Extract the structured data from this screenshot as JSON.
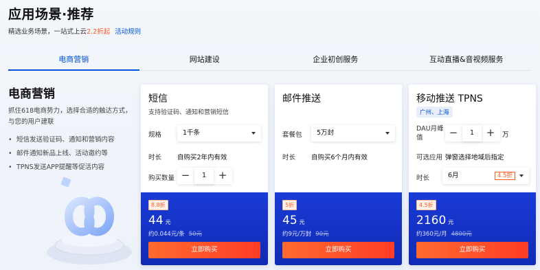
{
  "header": {
    "title": "应用场景·推荐",
    "subtitle_prefix": "精选业务场景，一站式上云",
    "subtitle_highlight": "2.2折起",
    "rule_link": "活动规则"
  },
  "tabs": [
    "电商营销",
    "网站建设",
    "企业初创服务",
    "互动直播&音视频服务"
  ],
  "intro": {
    "title": "电商营销",
    "desc": "抓住618电商势力，选择合适的触达方式，与您的用户建联",
    "bullets": [
      "短信发送验证码、通知和营销内容",
      "邮件通知新品上线、活动邀约等",
      "TPNS发送APP提醒等促活内容"
    ]
  },
  "cards": [
    {
      "title": "短信",
      "subtitle": "支持验证码、通知和营销短信",
      "spec_label": "规格",
      "spec_value": "1千条",
      "duration_label": "时长",
      "duration_value": "自购买2年内有效",
      "qty_label": "购买数量",
      "qty_value": "1",
      "discount": "8.8折",
      "price": "44",
      "price_unit": "元",
      "unit_price": "约0.044元/条",
      "orig_price": "50元",
      "buy_label": "立即购买"
    },
    {
      "title": "邮件推送",
      "package_label": "套餐包",
      "package_value": "5万封",
      "duration_label": "时长",
      "duration_value": "自购买6个月内有效",
      "discount": "5折",
      "price": "45",
      "price_unit": "元",
      "unit_price": "约9元/万封",
      "orig_price": "90元",
      "buy_label": "立即购买"
    },
    {
      "title": "移动推送 TPNS",
      "region_tag": "广州、上海",
      "dau_label": "DAU月峰值",
      "dau_value": "1",
      "dau_unit": "万",
      "app_label": "可选应用",
      "app_value": "弹窗选择地域后指定",
      "duration_label": "时长",
      "duration_value": "6月",
      "duration_discount": "4.5折",
      "discount": "4.5折",
      "price": "2160",
      "price_unit": "元",
      "unit_price": "约360元/月",
      "orig_price": "4800元",
      "buy_label": "立即购买"
    }
  ],
  "symbols": {
    "minus": "−",
    "plus": "+"
  },
  "colors": {
    "accent": "#0052d9",
    "price_bg": "#1a3bd6",
    "buy": "#ff5a1f"
  }
}
